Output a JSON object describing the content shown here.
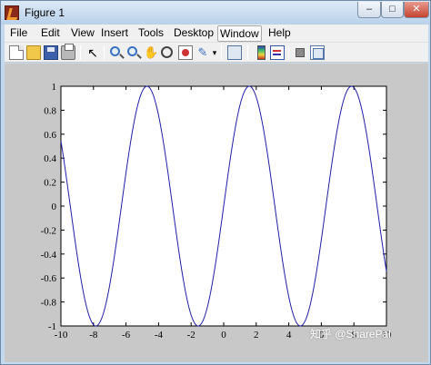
{
  "window": {
    "title": "Figure 1",
    "controls": {
      "minimize": "–",
      "maximize": "□",
      "close": "✕"
    }
  },
  "menu": {
    "items": [
      "File",
      "Edit",
      "View",
      "Insert",
      "Tools",
      "Desktop",
      "Window",
      "Help"
    ],
    "active": "Window"
  },
  "toolbar": {
    "icons": [
      "new-figure-icon",
      "open-file-icon",
      "save-icon",
      "print-icon",
      "edit-plot-arrow-icon",
      "zoom-in-icon",
      "zoom-out-icon",
      "pan-hand-icon",
      "rotate-3d-icon",
      "data-cursor-icon",
      "brush-icon",
      "brush-dropdown-icon",
      "link-plot-icon",
      "insert-colorbar-icon",
      "insert-legend-icon",
      "hide-plot-tools-icon",
      "show-plot-tools-icon"
    ],
    "arrow_glyph": "↖",
    "hand_glyph": "✋",
    "brush_glyph": "✎",
    "dropdown_glyph": "▾"
  },
  "watermark": "知乎 @SharePal",
  "chart_data": {
    "type": "line",
    "function": "sin(x)",
    "title": "",
    "xlabel": "",
    "ylabel": "",
    "xlim": [
      -10,
      10
    ],
    "ylim": [
      -1,
      1
    ],
    "grid": false,
    "x_ticks": [
      -10,
      -8,
      -6,
      -4,
      -2,
      0,
      2,
      4,
      6,
      8,
      10
    ],
    "y_ticks": [
      -1,
      -0.8,
      -0.6,
      -0.4,
      -0.2,
      0,
      0.2,
      0.4,
      0.6,
      0.8,
      1
    ],
    "x_tick_labels": [
      "-10",
      "-8",
      "-6",
      "-4",
      "-2",
      "0",
      "2",
      "4",
      "6",
      "8",
      "10"
    ],
    "y_tick_labels": [
      "-1",
      "-0.8",
      "-0.6",
      "-0.4",
      "-0.2",
      "0",
      "0.2",
      "0.4",
      "0.6",
      "0.8",
      "1"
    ],
    "series": [
      {
        "color": "#1f1fa8",
        "x": [
          -10,
          -9.5,
          -9,
          -8.5,
          -8,
          -7.5,
          -7,
          -6.5,
          -6,
          -5.5,
          -5,
          -4.5,
          -4,
          -3.5,
          -3,
          -2.5,
          -2,
          -1.5,
          -1,
          -0.5,
          0,
          0.5,
          1,
          1.5,
          2,
          2.5,
          3,
          3.5,
          4,
          4.5,
          5,
          5.5,
          6,
          6.5,
          7,
          7.5,
          8,
          8.5,
          9,
          9.5,
          10
        ],
        "y": [
          0.544,
          0.0752,
          -0.4121,
          -0.7985,
          -0.9894,
          -0.938,
          -0.657,
          -0.2151,
          0.2794,
          0.7055,
          0.9589,
          0.9775,
          0.7568,
          0.3508,
          -0.1411,
          -0.5985,
          -0.9093,
          -0.9975,
          -0.8415,
          -0.4794,
          0,
          0.4794,
          0.8415,
          0.9975,
          0.9093,
          0.5985,
          0.1411,
          -0.3508,
          -0.7568,
          -0.9775,
          -0.9589,
          -0.7055,
          -0.2794,
          0.2151,
          0.657,
          0.938,
          0.9894,
          0.7985,
          0.4121,
          -0.0752,
          -0.544
        ]
      }
    ]
  }
}
